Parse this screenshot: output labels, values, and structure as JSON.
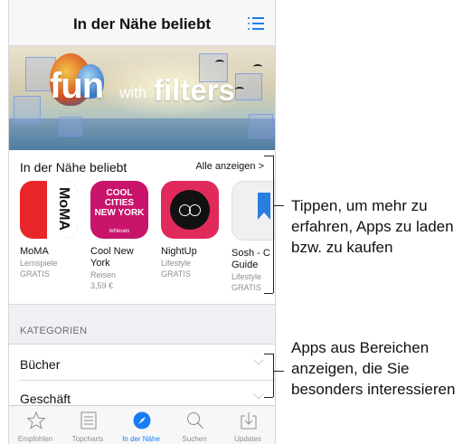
{
  "nav": {
    "title": "In der Nähe beliebt"
  },
  "banner": {
    "fun": "fun",
    "with": "with",
    "filters": "filters"
  },
  "section": {
    "title": "In der Nähe beliebt",
    "see_all": "Alle anzeigen >"
  },
  "apps": [
    {
      "name": "MoMA",
      "category": "Lernspiele",
      "price": "GRATIS",
      "icon_text": "MoMA"
    },
    {
      "name": "Cool New York",
      "category": "Reisen",
      "price": "3,59 €",
      "icon_text": "COOL CITIES NEW YORK",
      "icon_sub": "teNeues"
    },
    {
      "name": "NightUp",
      "category": "Lifestyle",
      "price": "GRATIS"
    },
    {
      "name": "Sosh - C Guide",
      "category": "Lifestyle",
      "price": "GRATIS"
    }
  ],
  "categories": {
    "header": "KATEGORIEN",
    "rows": [
      {
        "label": "Bücher"
      },
      {
        "label": "Geschäft"
      }
    ]
  },
  "tabs": [
    {
      "label": "Empfohlen",
      "icon": "star-icon"
    },
    {
      "label": "Topcharts",
      "icon": "list-icon"
    },
    {
      "label": "In der Nähe",
      "icon": "compass-icon",
      "active": true
    },
    {
      "label": "Suchen",
      "icon": "search-icon"
    },
    {
      "label": "Updates",
      "icon": "download-icon"
    }
  ],
  "annotations": {
    "first": "Tippen, um mehr zu erfahren, Apps zu laden bzw. zu kaufen",
    "second": "Apps aus Bereichen anzeigen, die Sie besonders interessieren"
  },
  "colors": {
    "accent": "#1a7cf5",
    "moma_red": "#e8262a",
    "cool_magenta": "#c8156b"
  }
}
